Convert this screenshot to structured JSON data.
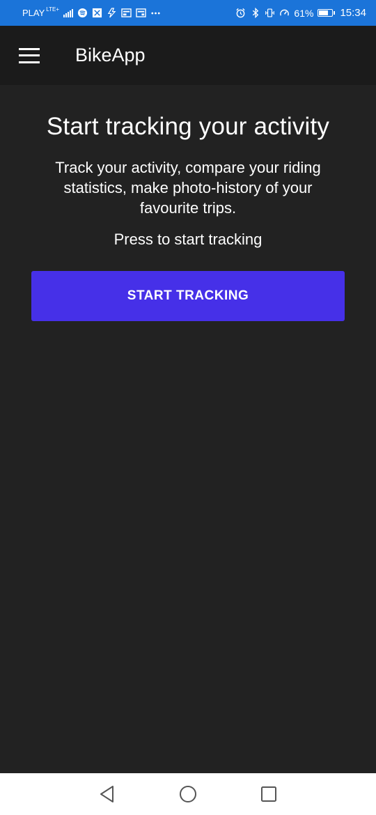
{
  "status_bar": {
    "carrier": "PLAY",
    "network": "LTE",
    "network_sub": "+",
    "battery_percent": "61%",
    "battery_level": 0.61,
    "time": "15:34",
    "icons": [
      "signal-icon",
      "spotify-icon",
      "vpn-icon",
      "data-icon",
      "news-icon",
      "calendar-icon",
      "more-icon",
      "alarm-icon",
      "bluetooth-icon",
      "vibrate-icon",
      "speed-icon",
      "battery-icon"
    ]
  },
  "app_bar": {
    "title": "BikeApp",
    "menu_icon": "hamburger-menu-icon"
  },
  "main": {
    "headline": "Start tracking your activity",
    "description": "Track your activity, compare your riding statistics, make photo-history of your favourite trips.",
    "hint": "Press to start tracking",
    "start_button_label": "START TRACKING"
  },
  "nav_bar": {
    "icons": [
      "back-icon",
      "home-icon",
      "recents-icon"
    ]
  },
  "colors": {
    "status_bar": "#1b74d9",
    "app_bar": "#1b1b1b",
    "background": "#222222",
    "accent": "#4630e8",
    "nav_bar": "#ffffff"
  }
}
